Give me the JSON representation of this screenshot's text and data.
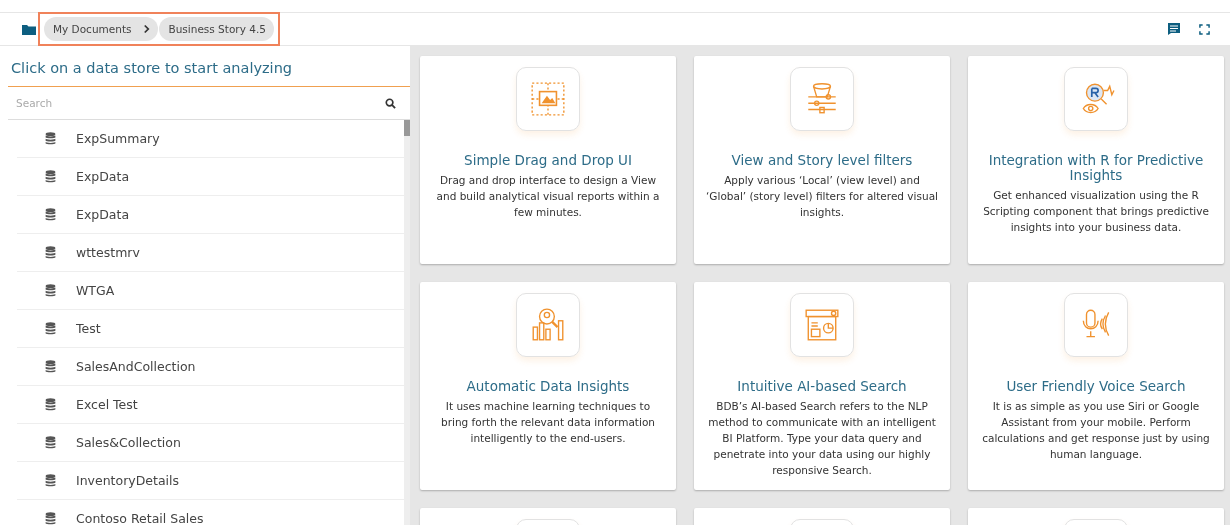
{
  "breadcrumbs": {
    "highlighted": true,
    "items": [
      {
        "label": "My Documents"
      },
      {
        "label": "Business Story 4.5"
      }
    ]
  },
  "sidebar": {
    "title": "Click on a data store to start analyzing",
    "search": {
      "placeholder": "Search"
    },
    "items": [
      {
        "label": "ExpSummary"
      },
      {
        "label": "ExpData"
      },
      {
        "label": "ExpData"
      },
      {
        "label": "wttestmrv"
      },
      {
        "label": "WTGA"
      },
      {
        "label": "Test"
      },
      {
        "label": "SalesAndCollection"
      },
      {
        "label": "Excel Test"
      },
      {
        "label": "Sales&Collection"
      },
      {
        "label": "InventoryDetails"
      },
      {
        "label": "Contoso Retail Sales"
      }
    ]
  },
  "cards": [
    {
      "kind": "dragdrop",
      "title": "Simple Drag and Drop UI",
      "text": "Drag and drop interface to design a View and build analytical visual reports within a few minutes."
    },
    {
      "kind": "filters",
      "title": "View and Story level filters",
      "text": "Apply various ‘Local’ (view level) and ‘Global’ (story level) filters for altered visual insights."
    },
    {
      "kind": "rscript",
      "title": "Integration with R for Predictive Insights",
      "text": "Get enhanced visualization using the R Scripting component that brings predictive insights into your business data."
    },
    {
      "kind": "insights",
      "title": "Automatic Data Insights",
      "text": "It uses machine learning techniques to bring forth the relevant data information intelligently to the end-users."
    },
    {
      "kind": "aisearch",
      "title": "Intuitive AI-based Search",
      "text": "BDB’s AI-based Search refers to the NLP method to communicate with an intelligent BI Platform. Type your data query and penetrate into your data using our highly responsive Search."
    },
    {
      "kind": "voice",
      "title": "User Friendly Voice Search",
      "text": "It is as simple as you use Siri or Google Assistant from your mobile. Perform calculations and get response just by using human language."
    },
    {
      "kind": "cut"
    },
    {
      "kind": "cut"
    },
    {
      "kind": "cut"
    }
  ]
}
